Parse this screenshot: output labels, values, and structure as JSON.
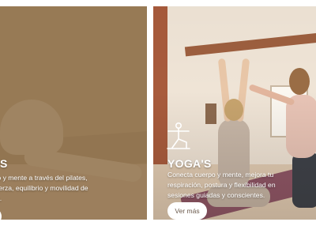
{
  "cards": [
    {
      "id": "pilates",
      "title": "S",
      "description_lines": [
        "erpo y mente a través del pilates,",
        "u fuerza, equilibrio y movilidad de",
        "iosa."
      ],
      "button_label": ""
    },
    {
      "id": "yoga",
      "title": "YOGA'S",
      "description": "Conecta cuerpo y mente, mejora tu respiración, postura y flexibilidad en sesiones guiadas y conscientes.",
      "button_label": "Ver más",
      "icon": "yoga-pose-icon"
    }
  ],
  "colors": {
    "overlay_brown": "#754f20",
    "button_text": "#6b5a4c"
  }
}
